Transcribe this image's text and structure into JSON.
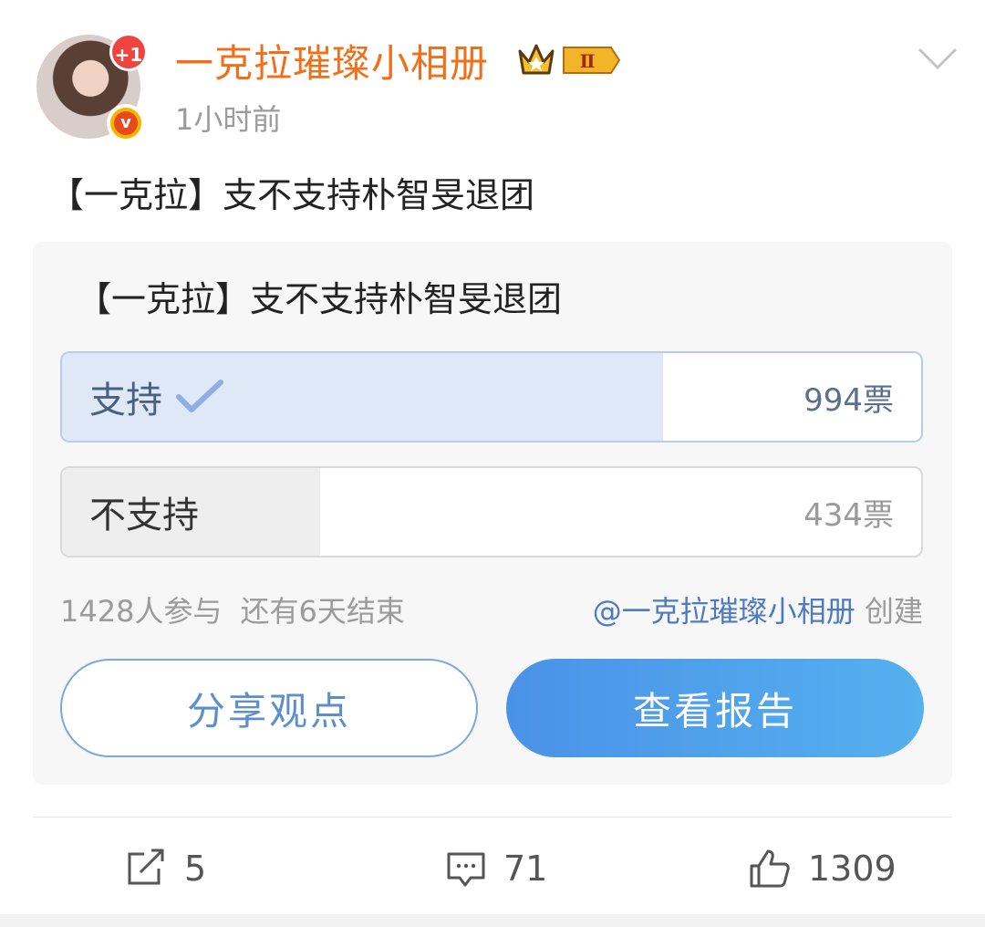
{
  "header": {
    "badge": "+1",
    "verified_letter": "v",
    "username": "一克拉璀璨小相册",
    "crown_level": "Ⅱ",
    "timestamp": "1小时前"
  },
  "post": {
    "text": "【一克拉】支不支持朴智旻退团"
  },
  "poll": {
    "title": "【一克拉】支不支持朴智旻退团",
    "options": [
      {
        "label": "支持",
        "votes": "994票",
        "share": 0.7,
        "selected": true
      },
      {
        "label": "不支持",
        "votes": "434票",
        "share": 0.3,
        "selected": false
      }
    ],
    "participants": "1428人参与",
    "time_left": "还有6天结束",
    "creator": "@一克拉璀璨小相册",
    "created_label": "创建",
    "share_button": "分享观点",
    "report_button": "查看报告"
  },
  "actions": {
    "repost_count": "5",
    "comment_count": "71",
    "like_count": "1309"
  },
  "colors": {
    "username": "#f26f1a",
    "link": "#4d7ac0",
    "primary_gradient_start": "#4a92e8",
    "primary_gradient_end": "#55b0ee"
  }
}
